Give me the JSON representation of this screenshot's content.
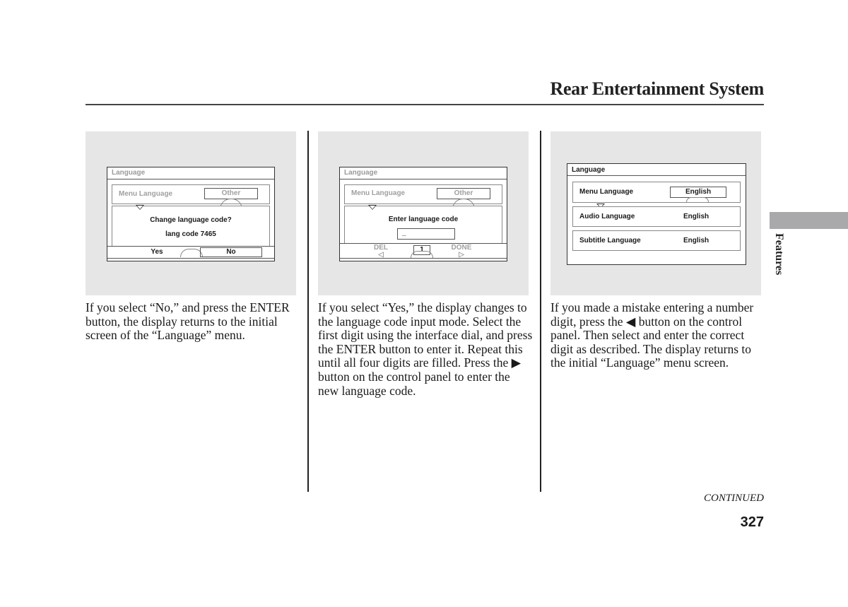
{
  "header": {
    "title": "Rear Entertainment System"
  },
  "side_tab": {
    "label": "Features"
  },
  "figures": [
    {
      "screen_title": "Language",
      "row_label": "Menu Language",
      "row_value": "Other",
      "dialog_line1": "Change language code?",
      "dialog_line2": "lang code 7465",
      "btn_yes": "Yes",
      "btn_no": "No",
      "selected_button": "No"
    },
    {
      "screen_title": "Language",
      "row_label": "Menu Language",
      "row_value": "Other",
      "dialog_line1": "Enter language code",
      "input_value": "_",
      "btn_del": "DEL",
      "digit": "1",
      "btn_done": "DONE",
      "del_arrow": "◁",
      "done_arrow": "▷"
    },
    {
      "screen_title": "Language",
      "rows": [
        {
          "label": "Menu Language",
          "value": "English"
        },
        {
          "label": "Audio Language",
          "value": "English"
        },
        {
          "label": "Subtitle Language",
          "value": "English"
        }
      ]
    }
  ],
  "captions": [
    "If you select “No,” and press the ENTER button, the display returns to the initial screen of the “Language” menu.",
    "If you select “Yes,” the display changes to the language code input mode. Select the first digit using the interface dial, and press the ENTER button to enter it. Repeat this until all four digits are filled. Press the ▶ button on the control panel to enter the new language code.",
    "If you made a mistake entering a number digit, press the ◀ button on the control panel. Then select and enter the correct digit as described. The display returns to the initial “Language” menu screen."
  ],
  "footer": {
    "continued": "CONTINUED",
    "page_number": "327"
  }
}
